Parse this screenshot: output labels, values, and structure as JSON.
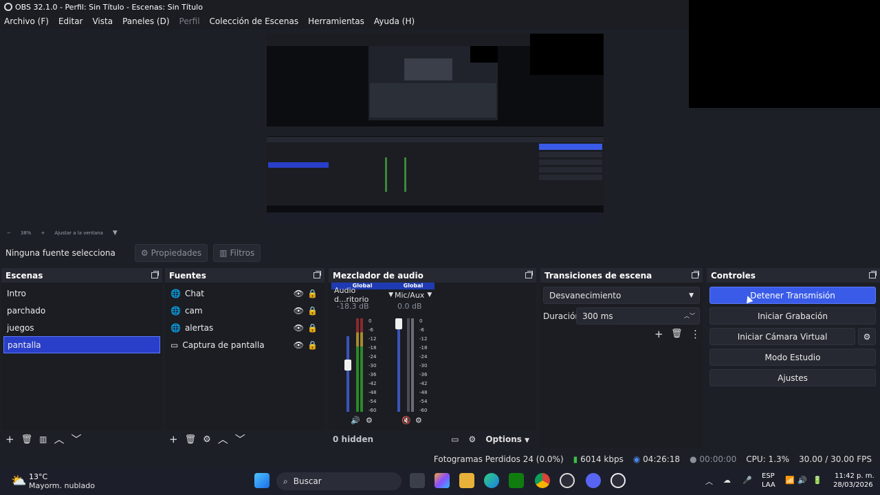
{
  "window": {
    "title": "OBS 32.1.0 - Perfil: Sin Título - Escenas: Sin Título"
  },
  "menu": [
    {
      "label": "Archivo (F)",
      "disabled": false
    },
    {
      "label": "Editar",
      "disabled": false
    },
    {
      "label": "Vista",
      "disabled": false
    },
    {
      "label": "Paneles (D)",
      "disabled": false
    },
    {
      "label": "Perfil",
      "disabled": true
    },
    {
      "label": "Colección de Escenas",
      "disabled": false
    },
    {
      "label": "Herramientas",
      "disabled": false
    },
    {
      "label": "Ayuda (H)",
      "disabled": false
    }
  ],
  "zoombar": {
    "minus": "−",
    "zoom": "38%",
    "plus": "+",
    "fit": "Ajustar a la ventana"
  },
  "context": {
    "no_source": "Ninguna fuente selecciona",
    "properties": "Propiedades",
    "filters": "Filtros"
  },
  "scenes": {
    "title": "Escenas",
    "items": [
      "Intro",
      "parchado",
      "juegos",
      "pantalla"
    ],
    "selected_index": 3
  },
  "sources": {
    "title": "Fuentes",
    "items": [
      {
        "label": "Chat",
        "icon": "globe-icon"
      },
      {
        "label": "cam",
        "icon": "globe-icon"
      },
      {
        "label": "alertas",
        "icon": "globe-icon"
      },
      {
        "label": "Captura de pantalla",
        "icon": "monitor-icon"
      }
    ]
  },
  "mixer": {
    "title": "Mezclador de audio",
    "channels": [
      {
        "global": "Global",
        "name": "Audio d...ritorio",
        "db": "-18.3 dB",
        "level": 0.62,
        "muted": false
      },
      {
        "global": "Global",
        "name": "Mic/Aux",
        "db": "0.0 dB",
        "level": 1.0,
        "muted": true
      }
    ],
    "scale": [
      "0",
      "-6",
      "-12",
      "-18",
      "-24",
      "-30",
      "-36",
      "-42",
      "-48",
      "-54",
      "-60"
    ],
    "hidden": "0 hidden",
    "options": "Options"
  },
  "transitions": {
    "title": "Transiciones de escena",
    "selected": "Desvanecimiento",
    "duration_label": "Duración",
    "duration_value": "300 ms"
  },
  "controls": {
    "title": "Controles",
    "stop_stream": "Detener Transmisión",
    "start_record": "Iniciar Grabación",
    "start_vcam": "Iniciar Cámara Virtual",
    "studio_mode": "Modo Estudio",
    "settings": "Ajustes"
  },
  "status": {
    "dropped": "Fotogramas Perdidos 24 (0.0%)",
    "bitrate": "6014 kbps",
    "stream_time": "04:26:18",
    "rec_time": "00:00:00",
    "cpu": "CPU: 1.3%",
    "fps": "30.00 / 30.00 FPS"
  },
  "taskbar": {
    "weather_temp": "13°C",
    "weather_desc": "Mayorm. nublado",
    "search": "Buscar",
    "lang": "ESP",
    "lang_sub": "LAA",
    "time": "11:42 p. m.",
    "date": "28/03/2026"
  },
  "colors": {
    "accent": "#3a5be8",
    "selected": "#2a3fc9",
    "panel": "#1b1d23",
    "header": "#262931"
  }
}
